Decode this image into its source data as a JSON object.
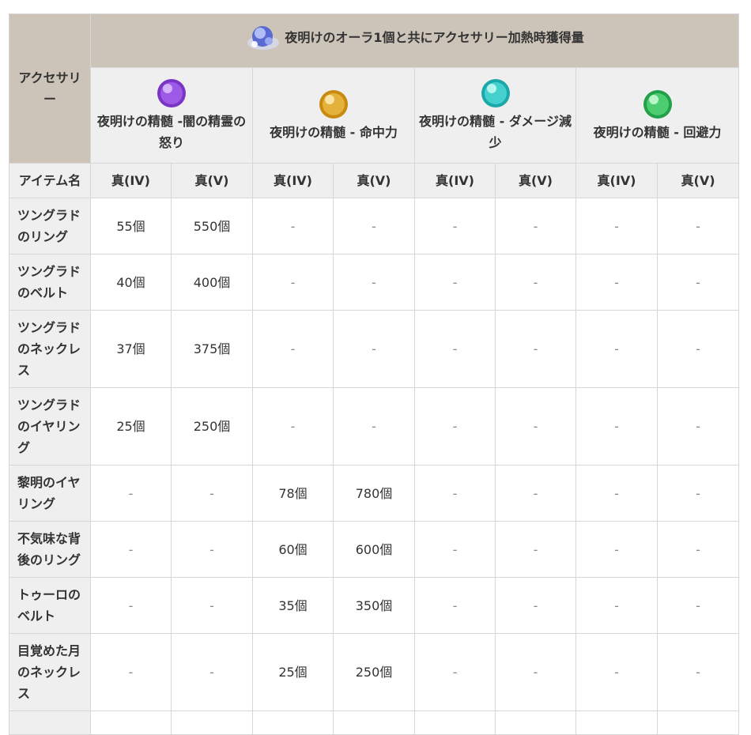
{
  "header": {
    "accessory_label": "アクセサリー",
    "title": "夜明けのオーラ1個と共にアクセサリー加熱時獲得量",
    "essences": [
      {
        "label": "夜明けの精髄 -闇の精霊の怒り",
        "color": "#8b45d6"
      },
      {
        "label": "夜明けの精髄 - 命中力",
        "color": "#d9a020"
      },
      {
        "label": "夜明けの精髄 - ダメージ減少",
        "color": "#2bbfc0"
      },
      {
        "label": "夜明けの精髄 - 回避力",
        "color": "#3cc060"
      }
    ],
    "item_name_label": "アイテム名",
    "grades": [
      "真(IV)",
      "真(V)",
      "真(IV)",
      "真(V)",
      "真(IV)",
      "真(V)",
      "真(IV)",
      "真(V)"
    ]
  },
  "rows": [
    {
      "name": "ツングラドのリング",
      "values": [
        "55個",
        "550個",
        "-",
        "-",
        "-",
        "-",
        "-",
        "-"
      ]
    },
    {
      "name": "ツングラドのベルト",
      "values": [
        "40個",
        "400個",
        "-",
        "-",
        "-",
        "-",
        "-",
        "-"
      ]
    },
    {
      "name": "ツングラドのネックレス",
      "values": [
        "37個",
        "375個",
        "-",
        "-",
        "-",
        "-",
        "-",
        "-"
      ]
    },
    {
      "name": "ツングラドのイヤリング",
      "values": [
        "25個",
        "250個",
        "-",
        "-",
        "-",
        "-",
        "-",
        "-"
      ]
    },
    {
      "name": "黎明のイヤリング",
      "values": [
        "-",
        "-",
        "78個",
        "780個",
        "-",
        "-",
        "-",
        "-"
      ]
    },
    {
      "name": "不気味な背後のリング",
      "values": [
        "-",
        "-",
        "60個",
        "600個",
        "-",
        "-",
        "-",
        "-"
      ]
    },
    {
      "name": "トゥーロのベルト",
      "values": [
        "-",
        "-",
        "35個",
        "350個",
        "-",
        "-",
        "-",
        "-"
      ]
    },
    {
      "name": "目覚めた月のネックレス",
      "values": [
        "-",
        "-",
        "25個",
        "250個",
        "-",
        "-",
        "-",
        "-"
      ]
    }
  ]
}
